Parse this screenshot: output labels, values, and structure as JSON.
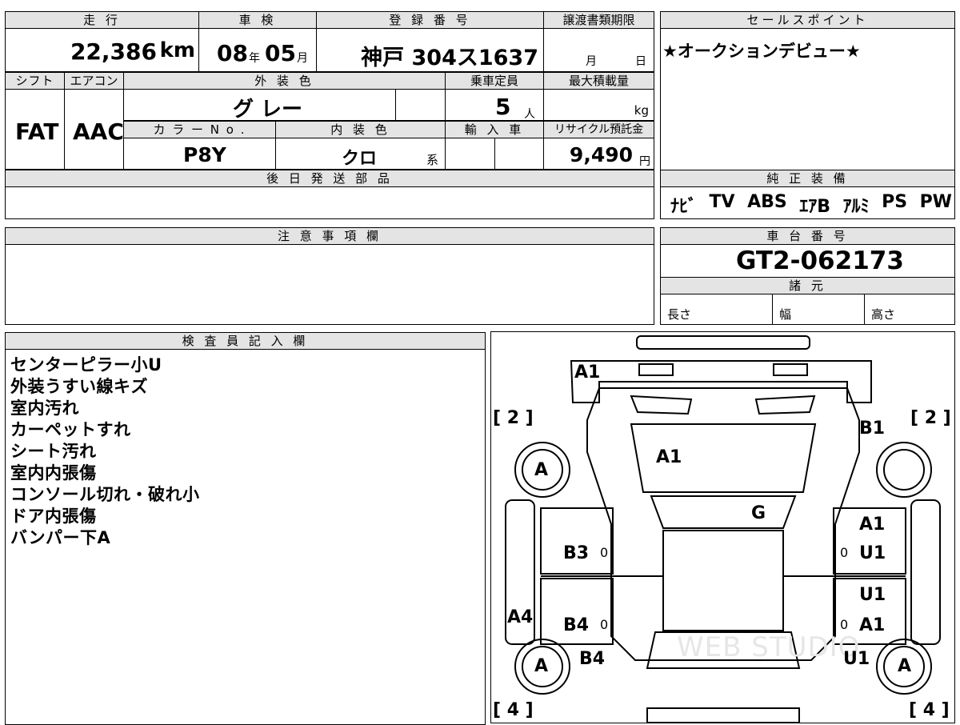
{
  "top": {
    "mileage_label": "走 行",
    "mileage_value": "22,386",
    "mileage_unit": "km",
    "inspection_label": "車 検",
    "inspection_year": "08",
    "inspection_year_unit": "年",
    "inspection_month": "05",
    "inspection_month_unit": "月",
    "registration_label": "登 録 番 号",
    "registration_value": "神戸 304ス1637",
    "transfer_label": "譲渡書類期限",
    "transfer_month_unit": "月",
    "transfer_day_unit": "日",
    "sales_label": "セールスポイント",
    "sales_text": "★オークションデビュー★"
  },
  "specs": {
    "shift_label": "シフト",
    "shift_value": "FAT",
    "aircon_label": "エアコン",
    "aircon_value": "AAC",
    "exterior_label": "外 装 色",
    "exterior_value": "グ レー",
    "capacity_label": "乗車定員",
    "capacity_value": "5",
    "capacity_unit": "人",
    "max_load_label": "最大積載量",
    "max_load_unit": "kg",
    "color_no_label": "カ ラ ー N o .",
    "color_no_value": "P8Y",
    "interior_label": "内 装 色",
    "interior_value": "クロ",
    "interior_suffix": "系",
    "import_label": "輸 入 車",
    "recycle_label": "リサイクル預託金",
    "recycle_value": "9,490",
    "recycle_unit": "円"
  },
  "later_parts": {
    "label": "後 日 発 送 部 品"
  },
  "equipment": {
    "label": "純 正 装 備",
    "items": [
      "ﾅﾋﾞ",
      "TV",
      "ABS",
      "ｴｱB",
      "ｱﾙﾐ",
      "PS",
      "PW"
    ]
  },
  "caution": {
    "label": "注 意 事 項 欄"
  },
  "chassis": {
    "label": "車 台 番 号",
    "value": "GT2-062173",
    "specs_label": "諸 元",
    "length_label": "長さ",
    "width_label": "幅",
    "height_label": "高さ"
  },
  "inspector": {
    "label": "検 査 員 記 入 欄",
    "notes": [
      "センターピラー小U",
      "外装うすい線キズ",
      "室内汚れ",
      "カーペットすれ",
      "シート汚れ",
      "室内内張傷",
      "コンソール切れ・破れ小",
      "ドア内張傷",
      "バンパー下A"
    ]
  },
  "diagram": {
    "marks": {
      "front_bumper": "A1",
      "windshield": "A1",
      "roof": "G",
      "left_front_fender": "[ 2 ]",
      "right_front_fender": "[ 2 ]",
      "right_front_marker": "B1",
      "left_front_tire": "A",
      "left_rear_tire": "A",
      "right_rear_tire": "A",
      "left_front_door": "B3",
      "left_rear_door": "B4",
      "left_rear_fender": "B4",
      "left_sill": "A4",
      "right_front_door_1": "A1",
      "right_front_door_2": "U1",
      "right_rear_door_1": "U1",
      "right_rear_door_2": "A1",
      "right_rear_fender": "U1",
      "left_rear_corner": "[ 4 ]",
      "right_rear_corner": "[ 4 ]",
      "zero": "0"
    },
    "watermark": "WEB STUDIO"
  }
}
